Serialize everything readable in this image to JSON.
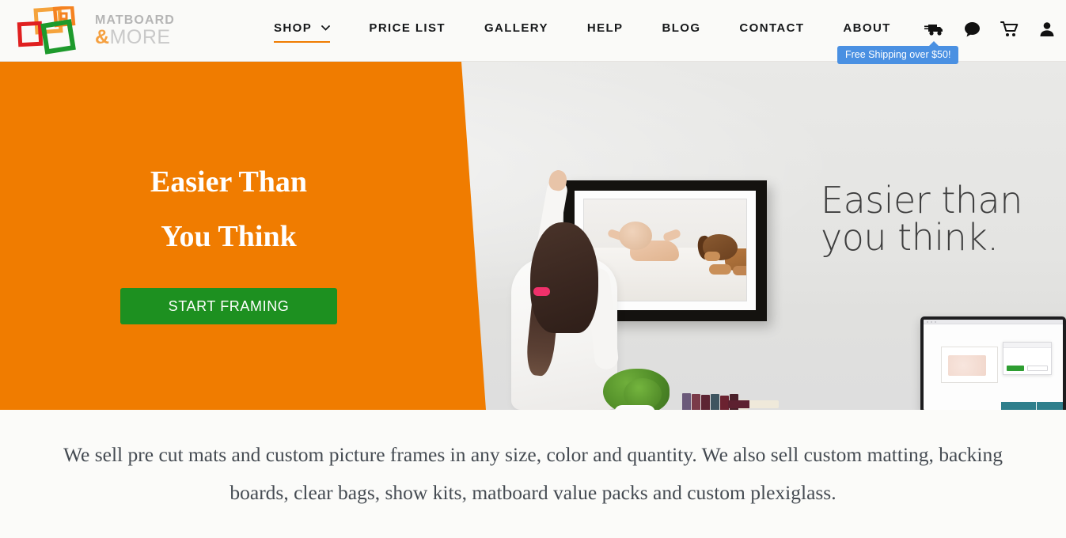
{
  "brand": {
    "name_line1": "MATBOARD",
    "name_line2_amp": "&",
    "name_line2": "MORE",
    "logo_icon": "overlapping-picture-frames-logo",
    "colors": {
      "orange": "#f07c00",
      "light_orange": "#f5a040",
      "red": "#e02020",
      "green": "#1d9020",
      "tooltip_blue": "#4a90e2",
      "header_bg": "#fafaf8",
      "body_bg": "#fbfbf9",
      "text_dark": "#16181a",
      "paragraph": "#454b52"
    }
  },
  "nav": {
    "items": [
      {
        "label": "SHOP",
        "active": true,
        "has_dropdown": true,
        "icon": "chevron-down-icon"
      },
      {
        "label": "PRICE LIST",
        "active": false,
        "has_dropdown": false,
        "icon": ""
      },
      {
        "label": "GALLERY",
        "active": false,
        "has_dropdown": false,
        "icon": ""
      },
      {
        "label": "HELP",
        "active": false,
        "has_dropdown": false,
        "icon": ""
      },
      {
        "label": "BLOG",
        "active": false,
        "has_dropdown": false,
        "icon": ""
      },
      {
        "label": "CONTACT",
        "active": false,
        "has_dropdown": false,
        "icon": ""
      },
      {
        "label": "ABOUT",
        "active": false,
        "has_dropdown": false,
        "icon": ""
      }
    ]
  },
  "header_icons": [
    {
      "name": "shipping-truck-icon",
      "label": "Shipping"
    },
    {
      "name": "chat-bubble-icon",
      "label": "Chat"
    },
    {
      "name": "shopping-cart-icon",
      "label": "Cart"
    },
    {
      "name": "user-account-icon",
      "label": "Account"
    }
  ],
  "tooltip": {
    "text": "Free Shipping over $50!"
  },
  "hero": {
    "title_line1": "Easier Than",
    "title_line2": "You Think",
    "cta_label": "START FRAMING",
    "wall_text_line1": "Easier than",
    "wall_text_line2": "you think.",
    "photo_description": "girl hanging framed photo of baby and puppy on wall above shelf with plant, books and computer monitor"
  },
  "intro": {
    "paragraph": "We sell pre cut mats and custom picture frames in any size, color and quantity. We also sell custom matting, backing boards, clear bags, show kits, matboard value packs and custom plexiglass."
  }
}
